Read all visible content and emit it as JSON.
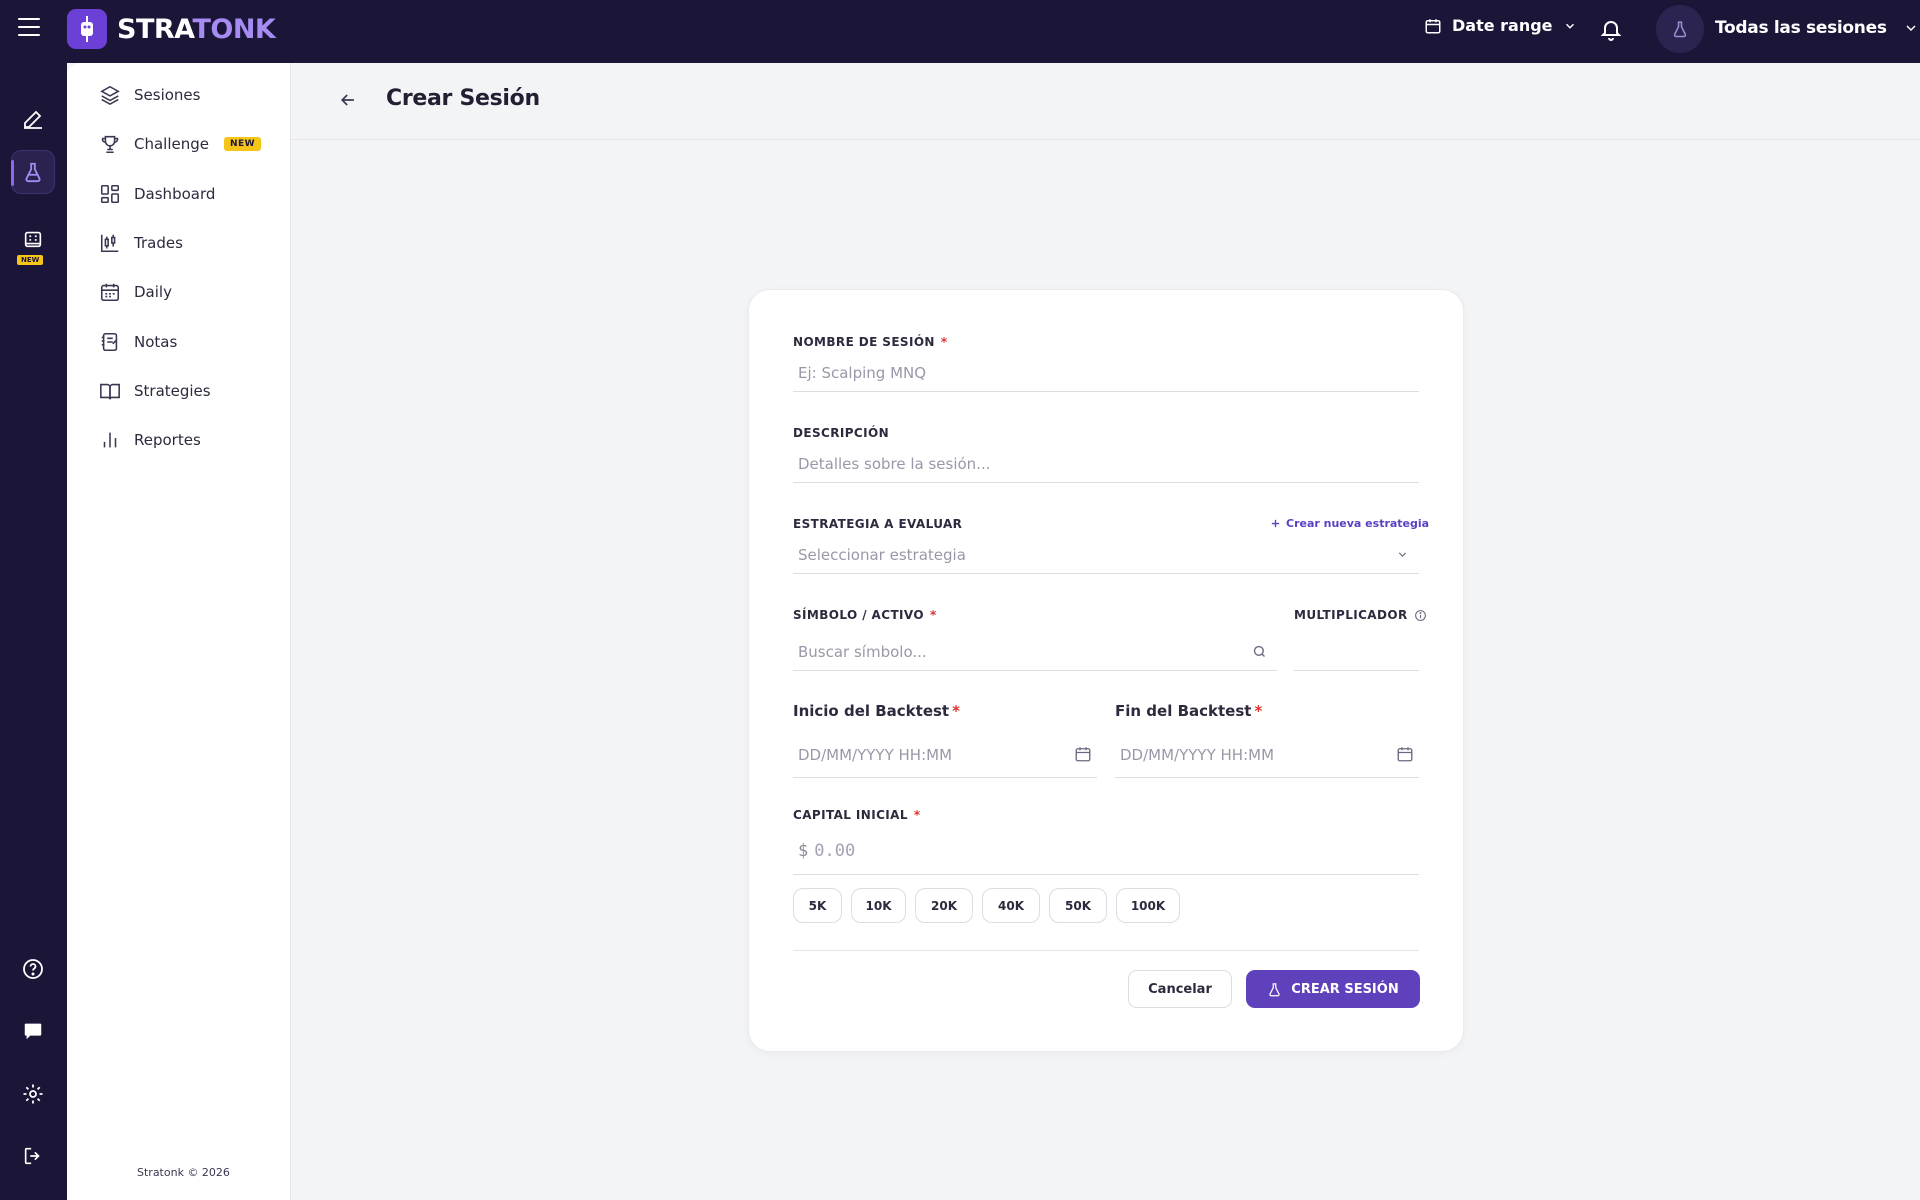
{
  "brand": {
    "name_part1": "STRA",
    "name_part2": "TONK"
  },
  "topbar": {
    "date_range_label": "Date range",
    "session_select_label": "Todas las sesiones"
  },
  "rail": {
    "new_badge": "NEW"
  },
  "sidebar": {
    "items": [
      {
        "label": "Sesiones",
        "icon": "layers-icon"
      },
      {
        "label": "Challenge",
        "icon": "trophy-icon",
        "badge": "NEW"
      },
      {
        "label": "Dashboard",
        "icon": "dashboard-icon"
      },
      {
        "label": "Trades",
        "icon": "candlestick-icon"
      },
      {
        "label": "Daily",
        "icon": "calendar-icon"
      },
      {
        "label": "Notas",
        "icon": "notes-icon"
      },
      {
        "label": "Strategies",
        "icon": "book-icon"
      },
      {
        "label": "Reportes",
        "icon": "bar-chart-icon"
      }
    ],
    "footer": "Stratonk © 2026"
  },
  "header": {
    "title": "Crear Sesión"
  },
  "form": {
    "session_name": {
      "label": "NOMBRE DE SESIÓN",
      "required": "*",
      "placeholder": "Ej: Scalping MNQ"
    },
    "description": {
      "label": "DESCRIPCIÓN",
      "placeholder": "Detalles sobre la sesión..."
    },
    "strategy": {
      "label": "ESTRATEGIA A EVALUAR",
      "create_link": "Crear nueva estrategia",
      "placeholder": "Seleccionar estrategia"
    },
    "symbol": {
      "label": "SÍMBOLO / ACTIVO",
      "required": "*",
      "placeholder": "Buscar símbolo..."
    },
    "multiplier": {
      "label": "MULTIPLICADOR"
    },
    "start": {
      "label": "Inicio del Backtest",
      "required": "*",
      "placeholder": "DD/MM/YYYY HH:MM"
    },
    "end": {
      "label": "Fin del Backtest",
      "required": "*",
      "placeholder": "DD/MM/YYYY HH:MM"
    },
    "capital": {
      "label": "CAPITAL INICIAL",
      "required": "*",
      "currency": "$",
      "placeholder": "0.00"
    },
    "presets": [
      "5K",
      "10K",
      "20K",
      "40K",
      "50K",
      "100K"
    ],
    "cancel_label": "Cancelar",
    "submit_label": "CREAR SESIÓN"
  },
  "colors": {
    "topbar": "#1b1537",
    "accent": "#5e41bb",
    "required": "#e03131",
    "badge": "#f5c518"
  }
}
